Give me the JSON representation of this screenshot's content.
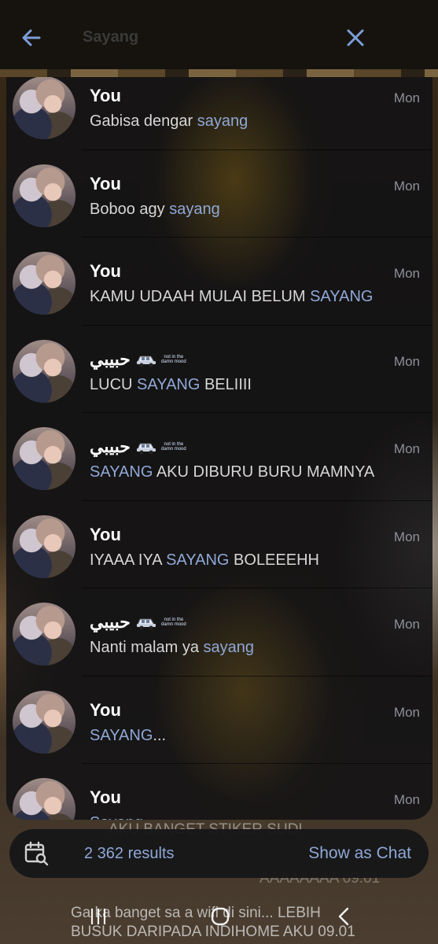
{
  "header": {
    "search_query": "Sayang",
    "back_icon": "arrow-left-icon",
    "close_icon": "close-icon"
  },
  "results": [
    {
      "name": "You",
      "time": "Mon",
      "pre": "Gabisa dengar ",
      "hl": "sayang",
      "post": "",
      "sticker": false
    },
    {
      "name": "You",
      "time": "Mon",
      "pre": "Boboo agy ",
      "hl": "sayang",
      "post": "",
      "sticker": false
    },
    {
      "name": "You",
      "time": "Mon",
      "pre": "KAMU UDAAH MULAI BELUM ",
      "hl": "SAYANG",
      "post": "",
      "sticker": false
    },
    {
      "name": "حبيبي",
      "time": "Mon",
      "pre": "LUCU ",
      "hl": "SAYANG",
      "post": " BELIIII",
      "sticker": true
    },
    {
      "name": "حبيبي",
      "time": "Mon",
      "pre": "",
      "hl": "SAYANG",
      "post": " AKU DIBURU BURU MAMNYA",
      "sticker": true
    },
    {
      "name": "You",
      "time": "Mon",
      "pre": "IYAAA IYA ",
      "hl": "SAYANG",
      "post": " BOLEEEHH",
      "sticker": false
    },
    {
      "name": "حبيبي",
      "time": "Mon",
      "pre": "Nanti malam ya ",
      "hl": "sayang",
      "post": "",
      "sticker": true
    },
    {
      "name": "You",
      "time": "Mon",
      "pre": "",
      "hl": "SAYANG",
      "post": "...",
      "sticker": false
    },
    {
      "name": "You",
      "time": "Mon",
      "pre": "",
      "hl": "Sayang",
      "post": "",
      "sticker": false
    }
  ],
  "sticker_text": "not in the damn mood",
  "background_chat": {
    "line1": "AKU BANGET STIKER SUDI",
    "line2": "AAAAAAAA 09.01",
    "line3": "Ga ka banget sa a wifi di sini... LEBIH",
    "line4": "BUSUK DARIPADA INDIHOME AKU 09.01"
  },
  "footer": {
    "results_count": "2 362 results",
    "show_as_chat": "Show as Chat",
    "calendar_icon": "calendar-search-icon"
  },
  "system_nav": {
    "recents_icon": "recents-icon",
    "home_icon": "home-icon",
    "back_icon": "nav-back-icon"
  },
  "colors": {
    "accent": "#8fa8d6",
    "panel": "#121214",
    "muted": "#8e9099"
  }
}
